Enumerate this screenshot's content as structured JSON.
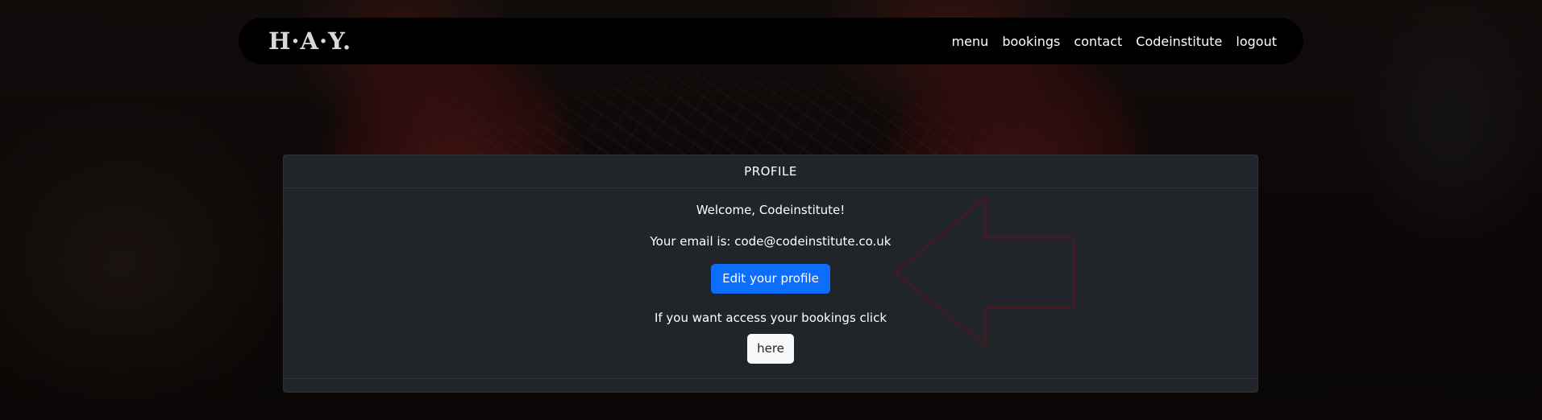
{
  "brand": "H·A·Y.",
  "nav": {
    "links": [
      "menu",
      "bookings",
      "contact",
      "Codeinstitute",
      "logout"
    ]
  },
  "profile": {
    "header": "PROFILE",
    "welcome": "Welcome, Codeinstitute!",
    "email_line": "Your email is: code@codeinstitute.co.uk",
    "edit_button": "Edit your profile",
    "bookings_text": "If you want access your bookings click",
    "here_button": "here"
  },
  "colors": {
    "primary": "#0d6efd",
    "card_bg": "#212529",
    "navbar_bg": "#000000",
    "arrow_stroke": "#5a1418"
  }
}
